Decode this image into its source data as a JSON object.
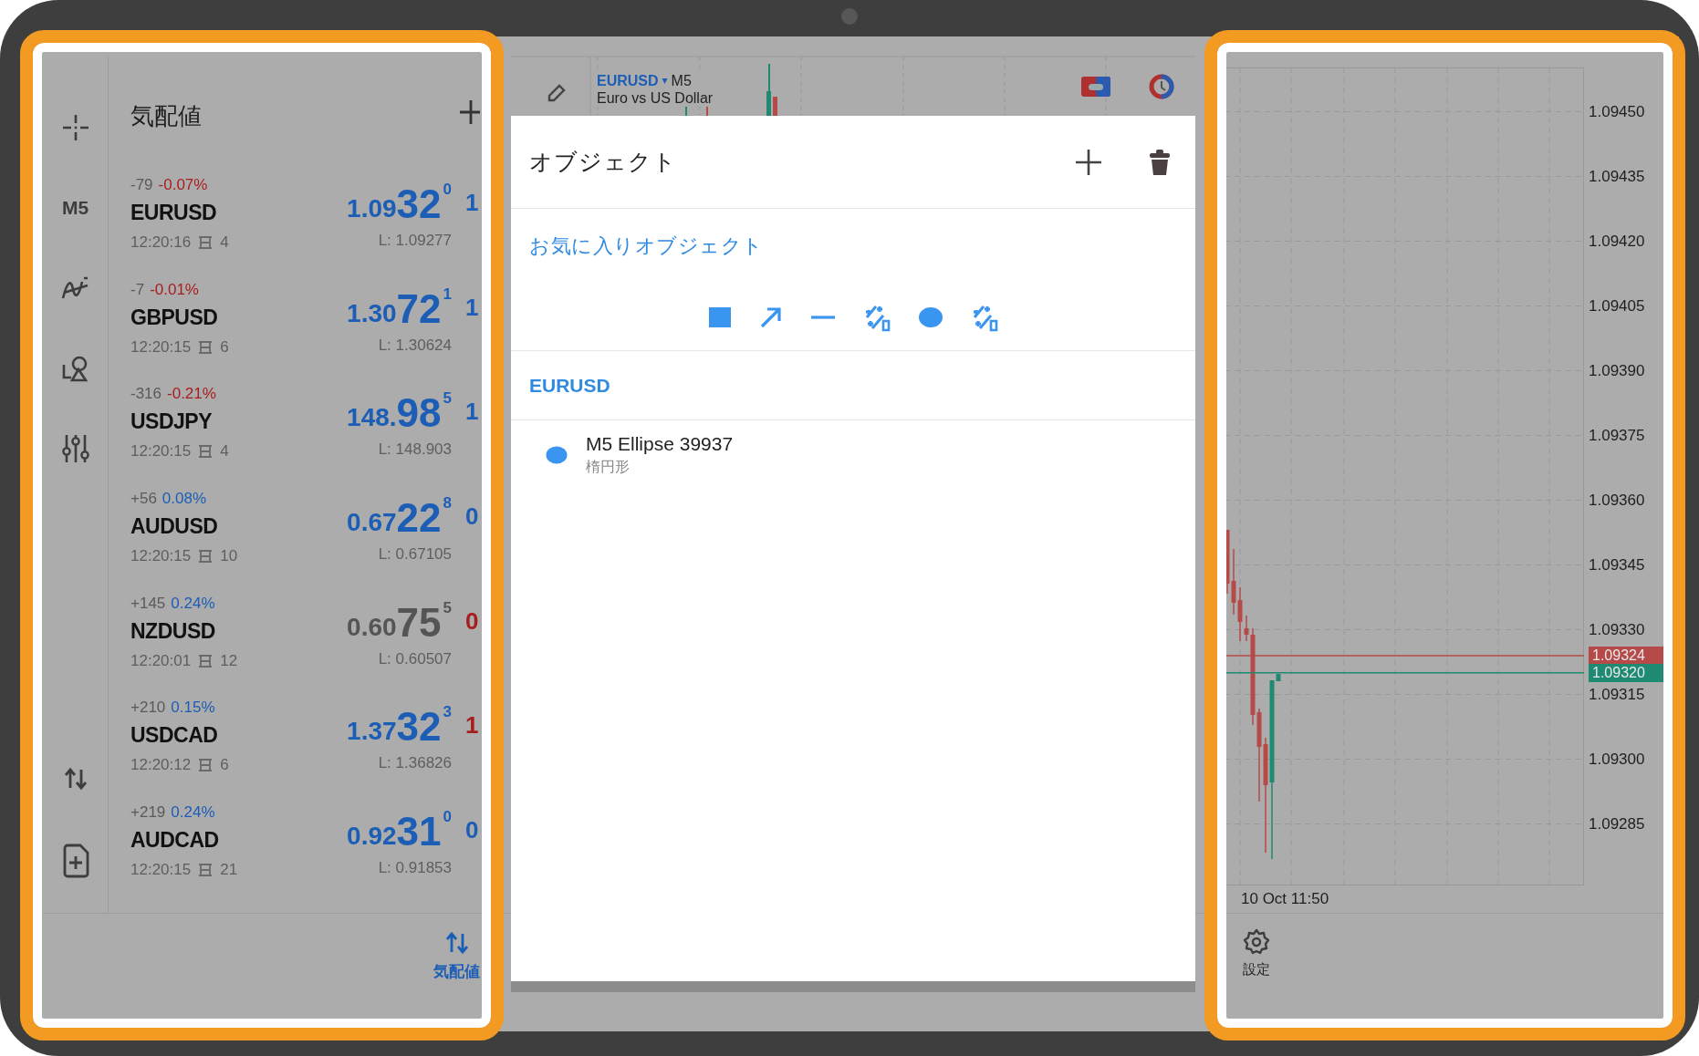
{
  "chart_header": {
    "symbol": "EURUSD",
    "dropdown": "▾",
    "timeframe": "M5",
    "description": "Euro vs US Dollar"
  },
  "sidebar": {
    "timeframe": "M5"
  },
  "watchlist": {
    "title": "気配値",
    "symbols": [
      {
        "change_points": "-79",
        "change_percent": {
          "text": "-0.07%",
          "color": "#a81e1e"
        },
        "symbol": "EURUSD",
        "time": "12:20:16",
        "spread": "4",
        "bid": {
          "prefix": "1.09",
          "big": "32",
          "last": "0",
          "color": "#1c5db5"
        },
        "low": "L: 1.09277",
        "ask": {
          "text": "1",
          "color": "#1c5db5"
        }
      },
      {
        "change_points": "-7",
        "change_percent": {
          "text": "-0.01%",
          "color": "#a81e1e"
        },
        "symbol": "GBPUSD",
        "time": "12:20:15",
        "spread": "6",
        "bid": {
          "prefix": "1.30",
          "big": "72",
          "last": "1",
          "color": "#1c5db5"
        },
        "low": "L: 1.30624",
        "ask": {
          "text": "1",
          "color": "#1c5db5"
        }
      },
      {
        "change_points": "-316",
        "change_percent": {
          "text": "-0.21%",
          "color": "#a81e1e"
        },
        "symbol": "USDJPY",
        "time": "12:20:15",
        "spread": "4",
        "bid": {
          "prefix": "148.",
          "big": "98",
          "last": "5",
          "color": "#1c5db5"
        },
        "low": "L: 148.903",
        "ask": {
          "text": "1",
          "color": "#1c5db5"
        }
      },
      {
        "change_points": "+56",
        "change_percent": {
          "text": "0.08%",
          "color": "#1c5db5"
        },
        "symbol": "AUDUSD",
        "time": "12:20:15",
        "spread": "10",
        "bid": {
          "prefix": "0.67",
          "big": "22",
          "last": "8",
          "color": "#1c5db5"
        },
        "low": "L: 0.67105",
        "ask": {
          "text": "0",
          "color": "#1c5db5"
        }
      },
      {
        "change_points": "+145",
        "change_percent": {
          "text": "0.24%",
          "color": "#1c5db5"
        },
        "symbol": "NZDUSD",
        "time": "12:20:01",
        "spread": "12",
        "bid": {
          "prefix": "0.60",
          "big": "75",
          "last": "5",
          "color": "#555555"
        },
        "low": "L: 0.60507",
        "ask": {
          "text": "0",
          "color": "#a81e1e"
        }
      },
      {
        "change_points": "+210",
        "change_percent": {
          "text": "0.15%",
          "color": "#1c5db5"
        },
        "symbol": "USDCAD",
        "time": "12:20:12",
        "spread": "6",
        "bid": {
          "prefix": "1.37",
          "big": "32",
          "last": "3",
          "color": "#1c5db5"
        },
        "low": "L: 1.36826",
        "ask": {
          "text": "1",
          "color": "#a81e1e"
        }
      },
      {
        "change_points": "+219",
        "change_percent": {
          "text": "0.24%",
          "color": "#1c5db5"
        },
        "symbol": "AUDCAD",
        "time": "12:20:15",
        "spread": "21",
        "bid": {
          "prefix": "0.92",
          "big": "31",
          "last": "0",
          "color": "#1c5db5"
        },
        "low": "L: 0.91853",
        "ask": {
          "text": "0",
          "color": "#1c5db5"
        }
      }
    ]
  },
  "bottom_nav": [
    {
      "label": "気配値",
      "selected": true
    }
  ],
  "objects_panel": {
    "title": "オブジェクト",
    "favorites_title": "お気に入りオブジェクト",
    "groups": [
      {
        "symbol": "EURUSD",
        "items": [
          {
            "name": "M5 Ellipse 39937",
            "type": "楕円形"
          }
        ]
      }
    ]
  },
  "chart": {
    "price_labels": [
      "1.09450",
      "1.09435",
      "1.09420",
      "1.09405",
      "1.09390",
      "1.09375",
      "1.09360",
      "1.09345",
      "1.09330",
      "1.09315",
      "1.09300",
      "1.09285"
    ],
    "price_tags": [
      {
        "value": "1.09324",
        "color": "#b54a48"
      },
      {
        "value": "1.09320",
        "color": "#1f8a72"
      }
    ],
    "time_label": "10 Oct 11:50"
  },
  "chart_toolbar": [
    {
      "label": "設定"
    }
  ]
}
